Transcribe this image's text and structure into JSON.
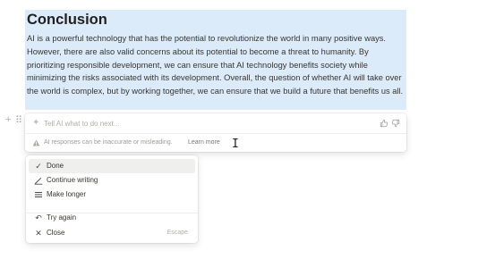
{
  "document": {
    "heading": "Conclusion",
    "paragraph": "AI is a powerful technology that has the potential to revolutionize the world in many positive ways. However, there are also valid concerns about its potential to become a threat to humanity. By prioritizing responsible development, we can ensure that AI technology benefits society while minimizing the risks associated with its development. Overall, the question of whether AI will take over the world is complex, but by working together, we can ensure that we build a future that benefits us all."
  },
  "ai_prompt": {
    "placeholder": "Tell AI what to do next...",
    "notice": "AI responses can be inaccurate or misleading.",
    "learn_more": "Learn more"
  },
  "menu": {
    "items": [
      {
        "label": "Done",
        "icon": "check-icon",
        "active": true
      },
      {
        "label": "Continue writing",
        "icon": "pencil-icon"
      },
      {
        "label": "Make longer",
        "icon": "lines-icon"
      }
    ],
    "secondary_items": [
      {
        "label": "Try again",
        "icon": "retry-icon"
      },
      {
        "label": "Close",
        "icon": "close-icon",
        "shortcut": "Escape"
      }
    ]
  },
  "colors": {
    "selection": "#dcebfa",
    "text": "#37352f",
    "muted": "#9b9a97",
    "hover": "#efefed"
  }
}
